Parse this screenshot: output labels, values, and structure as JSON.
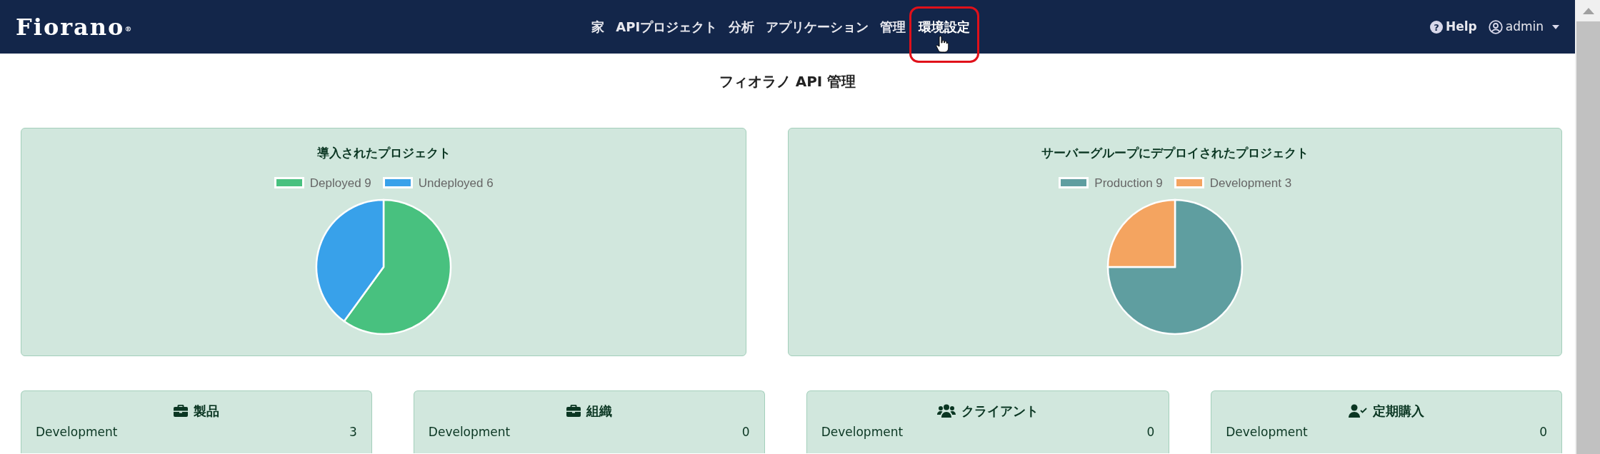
{
  "navbar": {
    "logo": "Fiorano$^{®}$",
    "items": [
      {
        "label": "家",
        "selected": false,
        "highlighted": false,
        "pointer": false
      },
      {
        "label": "APIプロジェクト",
        "selected": false,
        "highlighted": false,
        "pointer": false
      },
      {
        "label": "分析",
        "selected": false,
        "highlighted": false,
        "pointer": false
      },
      {
        "label": "アプリケーション",
        "selected": false,
        "highlighted": false,
        "pointer": false
      },
      {
        "label": "管理",
        "selected": false,
        "highlighted": false,
        "pointer": false
      },
      {
        "label": "環境設定",
        "selected": true,
        "highlighted": true,
        "pointer": true
      }
    ],
    "help_glyph": "?",
    "help": "Help",
    "user": "admin"
  },
  "page_title": "フィオラノ API 管理",
  "chart_panels": [
    {
      "title": "導入されたプロジェクト",
      "legend": [
        {
          "color": "#48c17f"
        },
        {
          "color": "#38a1ea"
        }
      ],
      "chart_data": {
        "type": "pie",
        "categories": [
          "Deployed 9",
          "Undeployed 6"
        ],
        "values": [
          9,
          6
        ]
      }
    },
    {
      "title": "サーバーグループにデプロイされたプロジェクト",
      "legend": [
        {
          "color": "#5f9ea0"
        },
        {
          "color": "#f4a460"
        }
      ],
      "chart_data": {
        "type": "pie",
        "categories": [
          "Production 9",
          "Development 3"
        ],
        "values": [
          9,
          3
        ]
      }
    }
  ],
  "stat_cards": [
    {
      "title": "製品",
      "kind": "briefcase",
      "rows": [
        {
          "label": "Development",
          "value": "3"
        }
      ]
    },
    {
      "title": "組織",
      "kind": "briefcase",
      "rows": [
        {
          "label": "Development",
          "value": "0"
        }
      ]
    },
    {
      "title": "クライアント",
      "kind": "users",
      "rows": [
        {
          "label": "Development",
          "value": "0"
        }
      ]
    },
    {
      "title": "定期購入",
      "kind": "user-check",
      "rows": [
        {
          "label": "Development",
          "value": "0"
        }
      ]
    }
  ]
}
